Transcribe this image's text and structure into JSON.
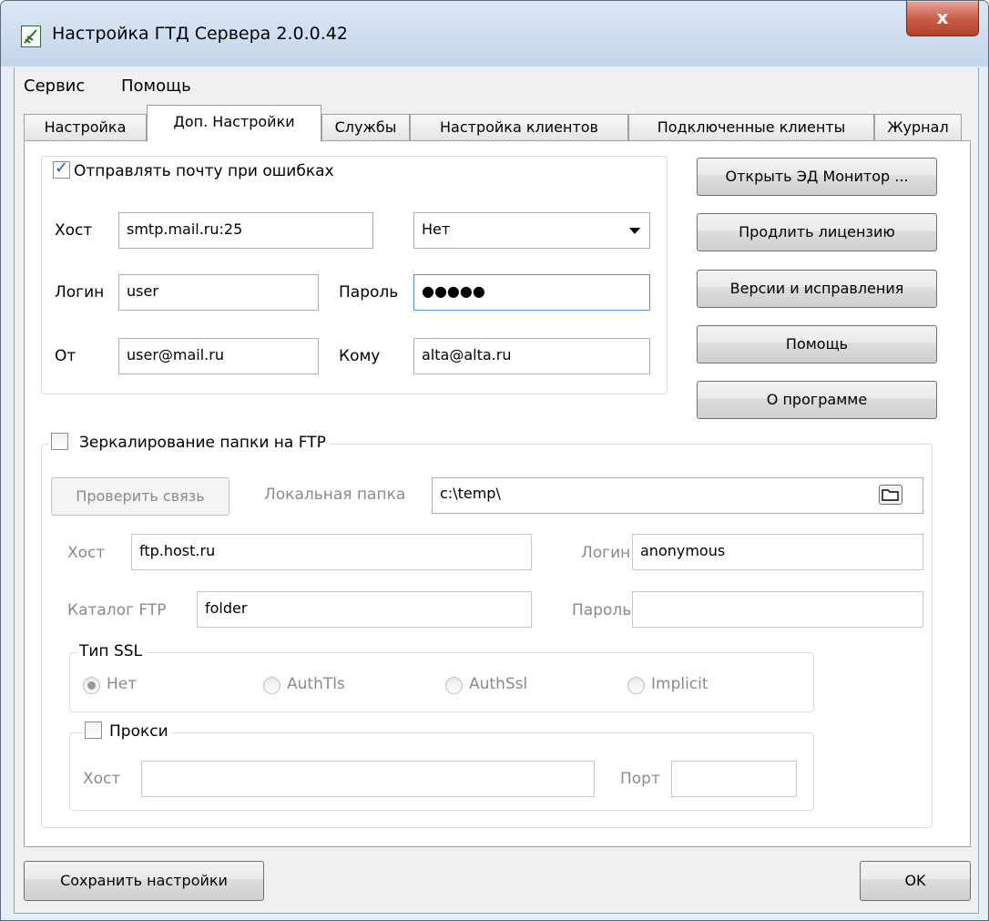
{
  "window": {
    "title": "Настройка ГТД Сервера 2.0.0.42",
    "close_glyph": "x"
  },
  "menu": [
    "Сервис",
    "Помощь"
  ],
  "tabs": [
    "Настройка",
    "Доп. Настройки",
    "Службы",
    "Настройка клиентов",
    "Подключенные клиенты",
    "Журнал"
  ],
  "mail": {
    "enabled_label": "Отправлять почту при ошибках",
    "enabled": true,
    "host_label": "Хост",
    "host_value": "smtp.mail.ru:25",
    "encryption_value": "Нет",
    "login_label": "Логин",
    "login_value": "user",
    "password_label": "Пароль",
    "password_value": "●●●●●",
    "from_label": "От",
    "from_value": "user@mail.ru",
    "to_label": "Кому",
    "to_value": "alta@alta.ru"
  },
  "side_buttons": [
    "Открыть ЭД Монитор ...",
    "Продлить лицензию",
    "Версии и исправления",
    "Помощь",
    "О программе"
  ],
  "ftp": {
    "enabled_label": "Зеркалирование папки на FTP",
    "enabled": false,
    "check_button": "Проверить связь",
    "local_folder_label": "Локальная папка",
    "local_folder_value": "c:\\temp\\",
    "host_label": "Хост",
    "host_value": "ftp.host.ru",
    "login_label": "Логин",
    "login_value": "anonymous",
    "catalog_label": "Каталог FTP",
    "catalog_value": "folder",
    "password_label": "Пароль",
    "password_value": "",
    "ssl": {
      "title": "Тип SSL",
      "options": [
        "Нет",
        "AuthTls",
        "AuthSsl",
        "Implicit"
      ],
      "selected": "Нет"
    },
    "proxy": {
      "label": "Прокси",
      "enabled": false,
      "host_label": "Хост",
      "host_value": "",
      "port_label": "Порт",
      "port_value": ""
    }
  },
  "footer": {
    "save_button": "Сохранить настройки",
    "ok_button": "OK"
  }
}
